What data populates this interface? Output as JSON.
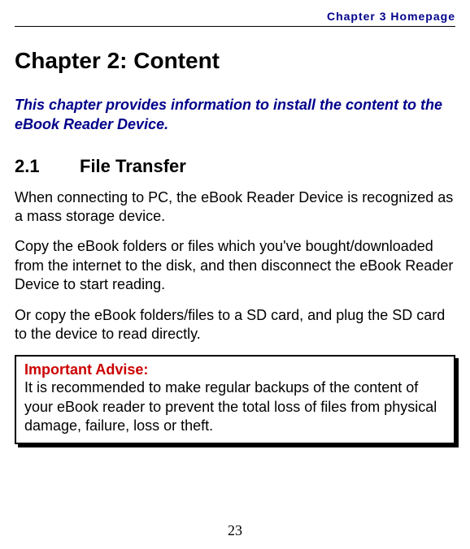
{
  "header": {
    "running_title": "Chapter 3 Homepage"
  },
  "chapter": {
    "title": "Chapter 2: Content",
    "intro": "This chapter provides information to install the content to the eBook Reader Device."
  },
  "section": {
    "number": "2.1",
    "title": "File Transfer",
    "paragraphs": [
      "When connecting to PC, the eBook Reader Device is recognized as a mass storage device.",
      "Copy the eBook folders or files which you've bought/downloaded from the internet to the disk, and then disconnect the eBook Reader Device to start reading.",
      "Or copy the eBook folders/files to a SD card, and plug the SD card to the device to read directly."
    ]
  },
  "advise": {
    "title": "Important Advise:",
    "body": "It is recommended to make regular backups of the content of your eBook reader to prevent the total loss of files from physical damage, failure, loss or theft."
  },
  "page_number": "23"
}
